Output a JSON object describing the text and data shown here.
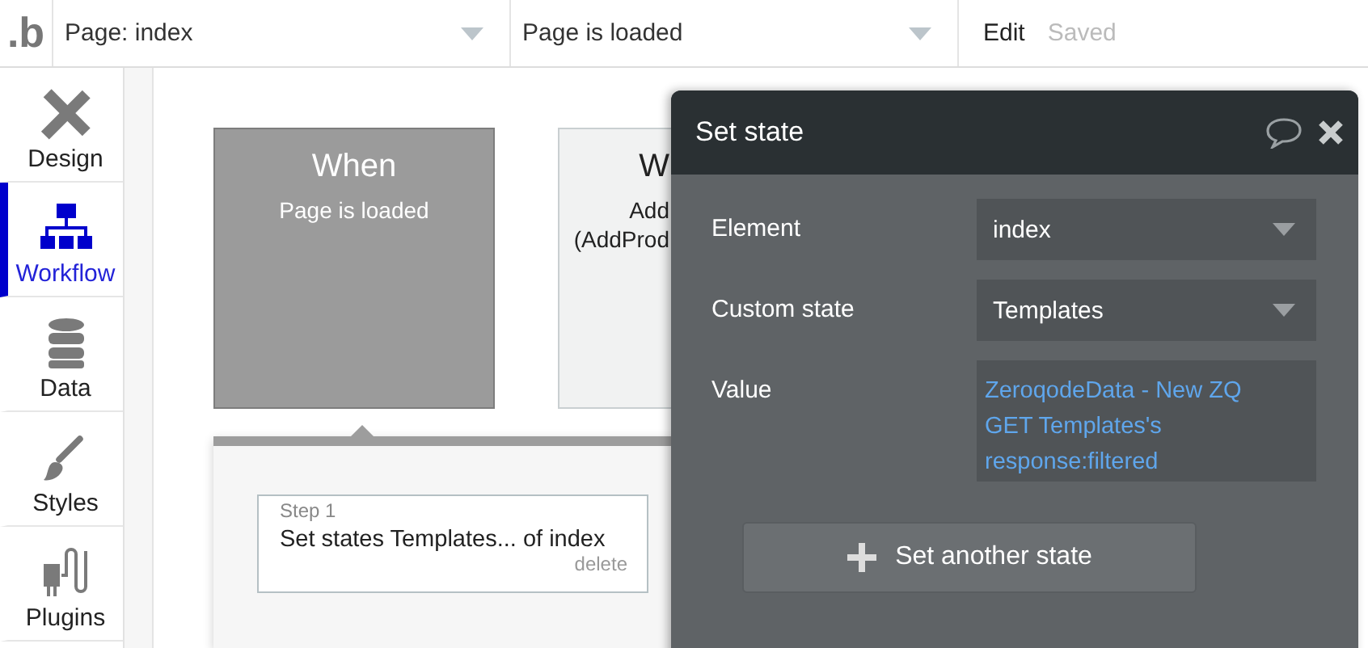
{
  "topbar": {
    "logo": ".b",
    "page_select": "Page: index",
    "event_select": "Page is loaded",
    "mode": "Edit",
    "save_status": "Saved"
  },
  "sidebar": {
    "items": [
      {
        "label": "Design",
        "kind": "design",
        "selected": false
      },
      {
        "label": "Workflow",
        "kind": "workflow",
        "selected": true
      },
      {
        "label": "Data",
        "kind": "data",
        "selected": false
      },
      {
        "label": "Styles",
        "kind": "styles",
        "selected": false
      },
      {
        "label": "Plugins",
        "kind": "plugins",
        "selected": false
      }
    ]
  },
  "canvas": {
    "events": [
      {
        "title": "When",
        "lines": [
          "Page is loaded"
        ],
        "selected": true
      },
      {
        "title": "W",
        "lines": [
          "Add",
          "(AddProd"
        ],
        "selected": false
      }
    ],
    "steps": [
      {
        "label": "Step 1",
        "action": "Set states Templates... of index",
        "delete": "delete"
      }
    ]
  },
  "dialog": {
    "title": "Set state",
    "fields": [
      {
        "label": "Element",
        "value": "index",
        "kind": "dropdown"
      },
      {
        "label": "Custom state",
        "value": "Templates",
        "kind": "dropdown"
      },
      {
        "label": "Value",
        "value": "ZeroqodeData - New ZQ GET Templates's response:filtered",
        "kind": "expression"
      }
    ],
    "button": "Set another state"
  }
}
